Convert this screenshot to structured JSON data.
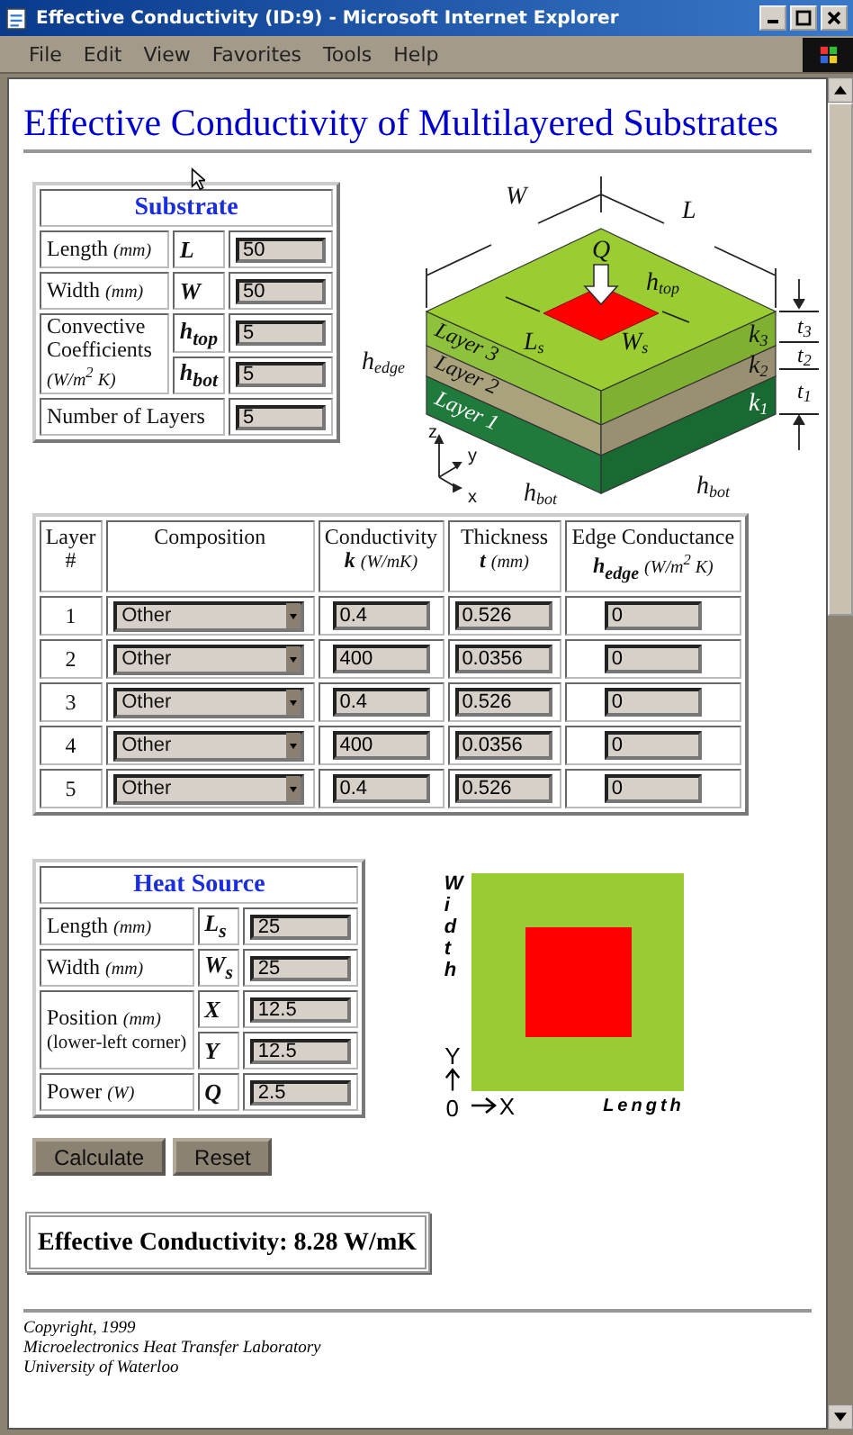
{
  "window": {
    "title": "Effective Conductivity (ID:9) - Microsoft Internet Explorer"
  },
  "menu": [
    "File",
    "Edit",
    "View",
    "Favorites",
    "Tools",
    "Help"
  ],
  "heading": "Effective Conductivity of Multilayered Substrates",
  "substrate": {
    "title": "Substrate",
    "fields": [
      {
        "kind": "single",
        "label": "Length",
        "unit": "(mm)",
        "symbol": "L",
        "value": "50"
      },
      {
        "kind": "single",
        "label": "Width",
        "unit": "(mm)",
        "symbol": "W",
        "value": "50"
      },
      {
        "kind": "group",
        "label": "Convective Coefficients",
        "unit": "(W/m$^{2}$ K)",
        "entries": [
          {
            "symbol": "h$_{top}$",
            "value": "5"
          },
          {
            "symbol": "h$_{bot}$",
            "value": "5"
          }
        ]
      },
      {
        "kind": "plain",
        "label": "Number of Layers",
        "value": "5"
      }
    ]
  },
  "diagram": {
    "labels": [
      {
        "text": "W"
      },
      {
        "text": "L"
      },
      {
        "text": "Q"
      },
      {
        "text": "h",
        "sub": "top"
      },
      {
        "text": "L",
        "sub": "s"
      },
      {
        "text": "W",
        "sub": "s"
      },
      {
        "text": "h",
        "sub": "edge"
      },
      {
        "text": "Layer 3"
      },
      {
        "text": "Layer 2"
      },
      {
        "text": "Layer 1"
      },
      {
        "text": "k",
        "sub": "3"
      },
      {
        "text": "k",
        "sub": "2"
      },
      {
        "text": "k",
        "sub": "1"
      },
      {
        "text": "t",
        "sub": "3"
      },
      {
        "text": "t",
        "sub": "2"
      },
      {
        "text": "t",
        "sub": "1"
      },
      {
        "text": "z"
      },
      {
        "text": "y"
      },
      {
        "text": "x"
      },
      {
        "text": "h",
        "sub": "bot"
      },
      {
        "text": "h",
        "sub": "bot"
      }
    ]
  },
  "layers": {
    "columns": [
      {
        "title": "Layer",
        "note": "#"
      },
      {
        "title": "Composition"
      },
      {
        "title": "Conductivity",
        "symbol": "k",
        "unit": "(W/mK)"
      },
      {
        "title": "Thickness",
        "symbol": "t",
        "unit": "(mm)"
      },
      {
        "title": "Edge Conductance",
        "symbol": "h$_{edge}$",
        "unit": "(W/m$^{2}$ K)"
      }
    ],
    "rows": [
      {
        "layer": "1",
        "composition": "Other",
        "conductivity": "0.4",
        "thickness": "0.526",
        "edge": "0"
      },
      {
        "layer": "2",
        "composition": "Other",
        "conductivity": "400",
        "thickness": "0.0356",
        "edge": "0"
      },
      {
        "layer": "3",
        "composition": "Other",
        "conductivity": "0.4",
        "thickness": "0.526",
        "edge": "0"
      },
      {
        "layer": "4",
        "composition": "Other",
        "conductivity": "400",
        "thickness": "0.0356",
        "edge": "0"
      },
      {
        "layer": "5",
        "composition": "Other",
        "conductivity": "0.4",
        "thickness": "0.526",
        "edge": "0"
      }
    ]
  },
  "heat_source": {
    "title": "Heat Source",
    "fields": [
      {
        "kind": "single",
        "label": "Length",
        "unit": "(mm)",
        "symbol": "L$_{s}$",
        "value": "25"
      },
      {
        "kind": "single",
        "label": "Width",
        "unit": "(mm)",
        "symbol": "W$_{s}$",
        "value": "25"
      },
      {
        "kind": "group",
        "label": "Position",
        "unit": "(mm)",
        "note": "(lower-left corner)",
        "entries": [
          {
            "symbol": "X",
            "value": "12.5"
          },
          {
            "symbol": "Y",
            "value": "12.5"
          }
        ]
      },
      {
        "kind": "single",
        "label": "Power",
        "unit": "(W)",
        "symbol": "Q",
        "value": "2.5"
      }
    ]
  },
  "plot": {
    "y_title": "Width",
    "y_axis": "Y",
    "origin": "0",
    "x_axis": "X",
    "x_title": "Length"
  },
  "buttons": [
    "Calculate",
    "Reset"
  ],
  "result": "Effective Conductivity: 8.28 W/mK",
  "footer": [
    "Copyright, 1999",
    "Microelectronics Heat Transfer Laboratory",
    "University of Waterloo"
  ]
}
